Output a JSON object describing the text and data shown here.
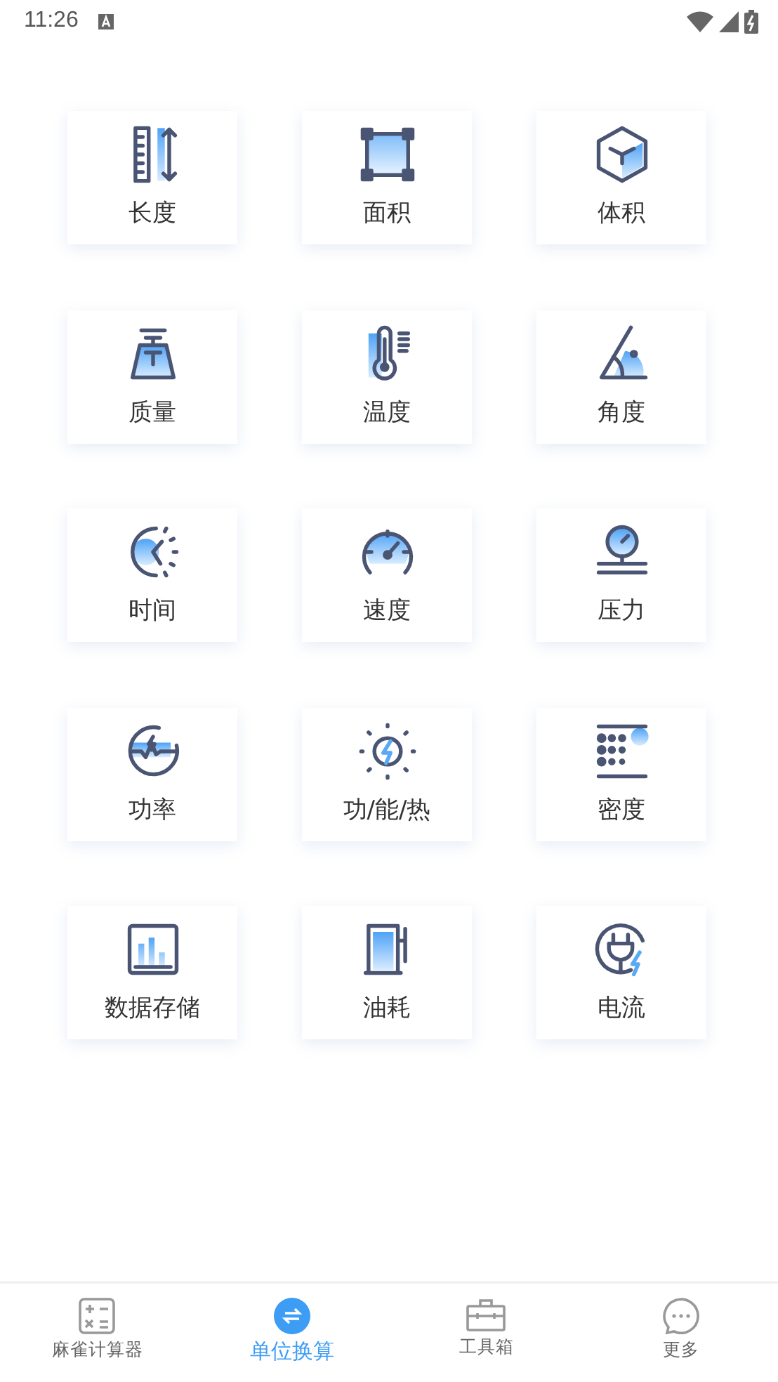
{
  "status_bar": {
    "time": "11:26"
  },
  "units": [
    {
      "label": "长度"
    },
    {
      "label": "面积"
    },
    {
      "label": "体积"
    },
    {
      "label": "质量"
    },
    {
      "label": "温度"
    },
    {
      "label": "角度"
    },
    {
      "label": "时间"
    },
    {
      "label": "速度"
    },
    {
      "label": "压力"
    },
    {
      "label": "功率"
    },
    {
      "label": "功/能/热"
    },
    {
      "label": "密度"
    },
    {
      "label": "数据存储"
    },
    {
      "label": "油耗"
    },
    {
      "label": "电流"
    }
  ],
  "tab_bar": [
    {
      "label": "麻雀计算器",
      "selected": false
    },
    {
      "label": "单位换算",
      "selected": true
    },
    {
      "label": "工具箱",
      "selected": false
    },
    {
      "label": "更多",
      "selected": false
    }
  ]
}
